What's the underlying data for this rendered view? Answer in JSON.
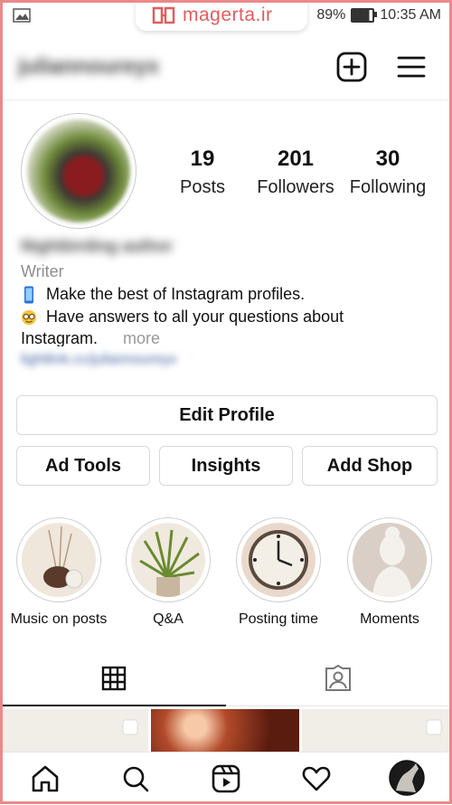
{
  "status_bar": {
    "battery": "89%",
    "time": "10:35 AM"
  },
  "watermark": {
    "text": "magerta.ir"
  },
  "header": {
    "username": "juliannoureyx"
  },
  "profile": {
    "stats": [
      {
        "value": "19",
        "label": "Posts"
      },
      {
        "value": "201",
        "label": "Followers"
      },
      {
        "value": "30",
        "label": "Following"
      }
    ],
    "display_name": "Nightbirding author",
    "category": "Writer",
    "bio_lines": [
      {
        "icon": "mobile-phone-icon",
        "text": "Make the best of Instagram profiles."
      },
      {
        "icon": "nerd-face-icon",
        "text": "Have answers to all your questions about"
      }
    ],
    "bio_last": "Instagram.",
    "more_label": "more",
    "link": "lightlink.cc/juliannoureyx"
  },
  "buttons": {
    "edit_profile": "Edit Profile",
    "ad_tools": "Ad Tools",
    "insights": "Insights",
    "add_shop": "Add Shop"
  },
  "highlights": [
    {
      "label": "Music on posts"
    },
    {
      "label": "Q&A"
    },
    {
      "label": "Posting time"
    },
    {
      "label": "Moments"
    }
  ],
  "tabs": [
    {
      "name": "grid",
      "icon": "grid-icon",
      "active": true
    },
    {
      "name": "tagged",
      "icon": "tagged-person-icon",
      "active": false
    }
  ],
  "bottom_nav": [
    {
      "icon": "home-icon"
    },
    {
      "icon": "search-icon"
    },
    {
      "icon": "reels-icon"
    },
    {
      "icon": "heart-icon"
    },
    {
      "icon": "profile-avatar"
    }
  ],
  "colors": {
    "watermark": "#e25d5d",
    "secondary_text": "#8e8e8e",
    "border": "#d8d8d8"
  }
}
